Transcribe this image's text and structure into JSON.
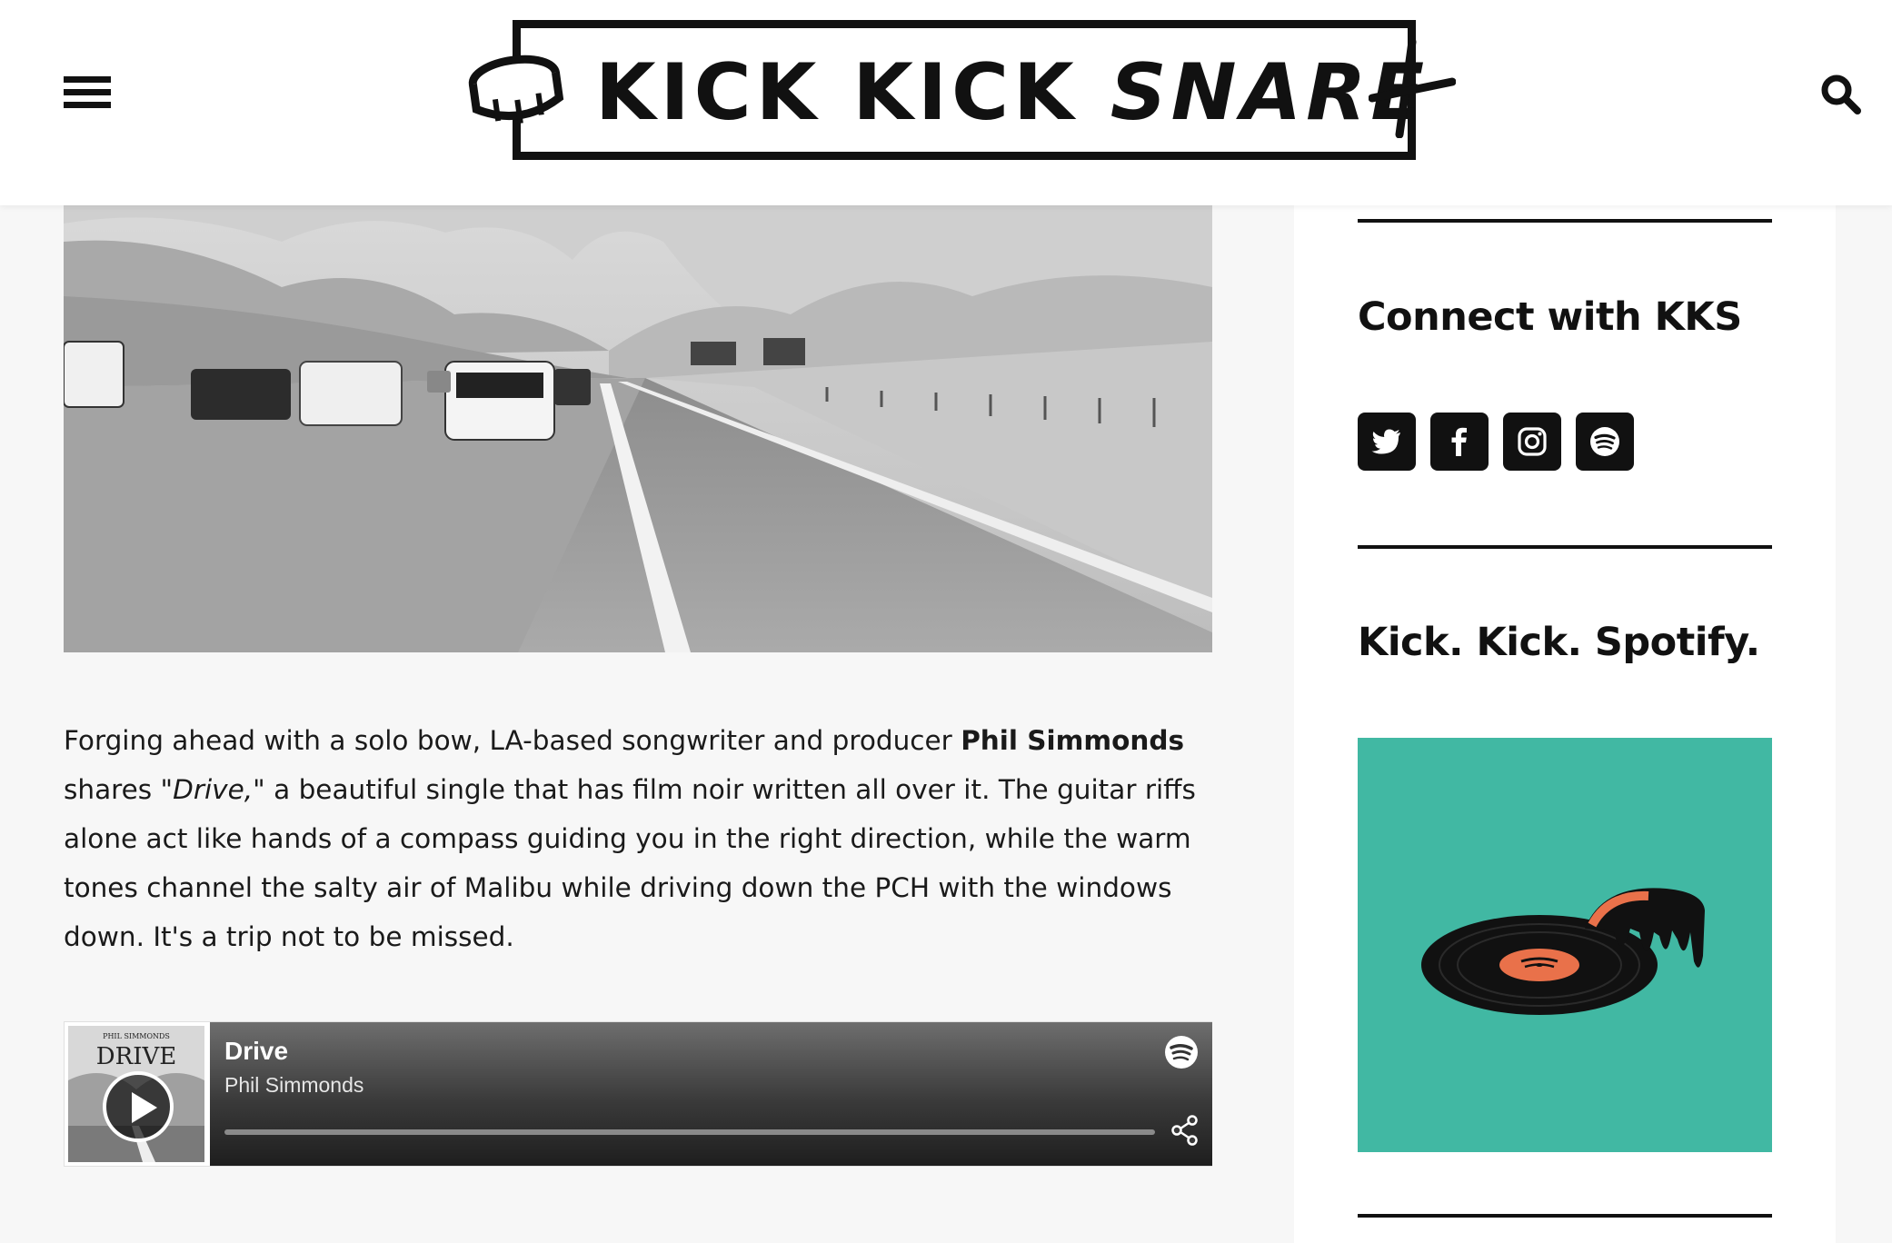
{
  "header": {
    "logo_text_regular": "KICK KICK",
    "logo_text_italic": "SNARE",
    "menu_icon": "hamburger-menu-icon",
    "search_icon": "search-icon"
  },
  "article": {
    "text_before_name": "Forging ahead with a solo bow, LA-based songwriter and producer",
    "artist_name": "Phil Simmonds",
    "text_mid_1": "shares",
    "song_title_quoted": "\"Drive,\"",
    "text_after": "a beautiful single that has film noir written all over it. The guitar riffs alone act like hands of a compass guiding you in the right direction, while the warm tones channel the salty air of Malibu while driving down the PCH with the windows down. It's a trip not to be missed."
  },
  "player": {
    "track_title": "Drive",
    "artist": "Phil Simmonds",
    "art_text_top": "PHIL SIMMONDS",
    "art_text_title": "DRIVE",
    "progress": 0.0,
    "icons": [
      "play-icon",
      "spotify-icon",
      "share-icon"
    ]
  },
  "sidebar": {
    "connect_heading": "Connect with KKS",
    "social_icons": [
      "twitter-icon",
      "facebook-icon",
      "instagram-icon",
      "spotify-icon"
    ],
    "spotify_heading": "Kick. Kick. Spotify."
  },
  "colors": {
    "promo_teal": "#41b8a3",
    "record_label_orange": "#e9714a",
    "page_background": "#f7f7f7"
  }
}
